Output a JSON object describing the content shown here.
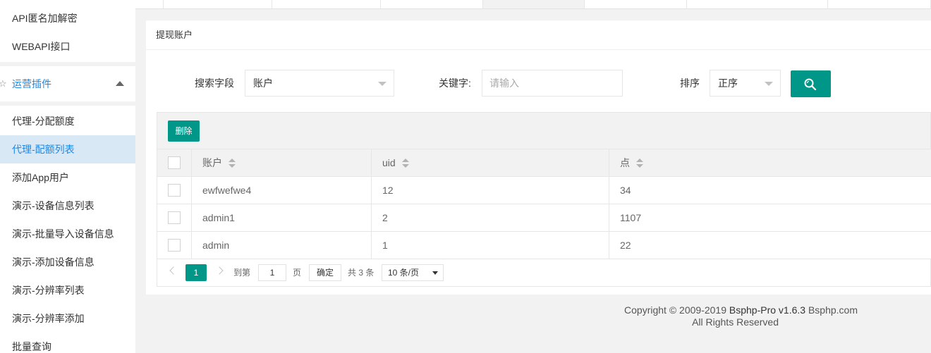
{
  "sidebar": {
    "items_top": [
      "API匿名加解密",
      "WEBAPI接口"
    ],
    "group": {
      "label": "运营插件",
      "icon": "star-icon",
      "expanded": true
    },
    "items": [
      "代理-分配额度",
      "代理-配额列表",
      "添加App用户",
      "演示-设备信息列表",
      "演示-批量导入设备信息",
      "演示-添加设备信息",
      "演示-分辨率列表",
      "演示-分辨率添加",
      "批量查询"
    ],
    "active_item": "代理-配额列表"
  },
  "card": {
    "title": "提现账户",
    "search": {
      "field_label": "搜索字段",
      "field_value": "账户",
      "keyword_label": "关键字:",
      "keyword_placeholder": "请输入",
      "sort_label": "排序",
      "sort_value": "正序",
      "search_icon": "search-icon"
    },
    "delete_label": "删除",
    "table": {
      "headers": [
        "账户",
        "uid",
        "点"
      ],
      "rows": [
        [
          "ewfwefwe4",
          "12",
          "34"
        ],
        [
          "admin1",
          "2",
          "1107"
        ],
        [
          "admin",
          "1",
          "22"
        ]
      ]
    },
    "pager": {
      "current": "1",
      "goto_label": "到第",
      "goto_value": "1",
      "page_unit": "页",
      "confirm_label": "确定",
      "total_label": "共 3 条",
      "page_size": "10 条/页"
    }
  },
  "footer": {
    "copyright": "Copyright © 2009-2019 ",
    "product": "Bsphp-Pro v1.6.3",
    "site": " Bsphp.com",
    "rights": "All Rights Reserved"
  },
  "colors": {
    "accent": "#009688",
    "link": "#1e88e5",
    "active_bg": "#d9e8f5"
  }
}
